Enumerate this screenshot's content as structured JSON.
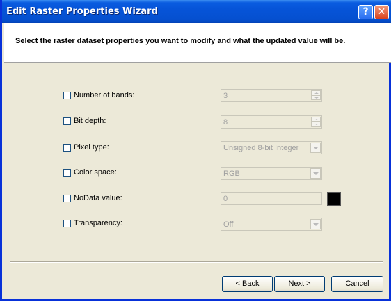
{
  "window": {
    "title": "Edit Raster Properties Wizard",
    "help_glyph": "?",
    "close_glyph": "✕"
  },
  "header": {
    "instruction": "Select the raster dataset properties you want to modify and what the updated value will be."
  },
  "properties": [
    {
      "label": "Number of bands:",
      "value": "3",
      "control": "spinner",
      "checked": false,
      "enabled": false
    },
    {
      "label": "Bit depth:",
      "value": "8",
      "control": "spinner",
      "checked": false,
      "enabled": false
    },
    {
      "label": "Pixel type:",
      "value": "Unsigned 8-bit Integer",
      "control": "dropdown",
      "checked": false,
      "enabled": false
    },
    {
      "label": "Color space:",
      "value": "RGB",
      "control": "dropdown",
      "checked": false,
      "enabled": false
    },
    {
      "label": "NoData value:",
      "value": "0",
      "control": "textbox",
      "checked": false,
      "enabled": false
    },
    {
      "label": "Transparency:",
      "value": "Off",
      "control": "dropdown",
      "checked": false,
      "enabled": false
    }
  ],
  "nodata_color": "#000000",
  "buttons": {
    "back": "< Back",
    "next": "Next >",
    "cancel": "Cancel"
  },
  "colors": {
    "title_bar": "#0654d8",
    "dialog_bg": "#ece9d8",
    "disabled_text": "#a0a0a0"
  }
}
